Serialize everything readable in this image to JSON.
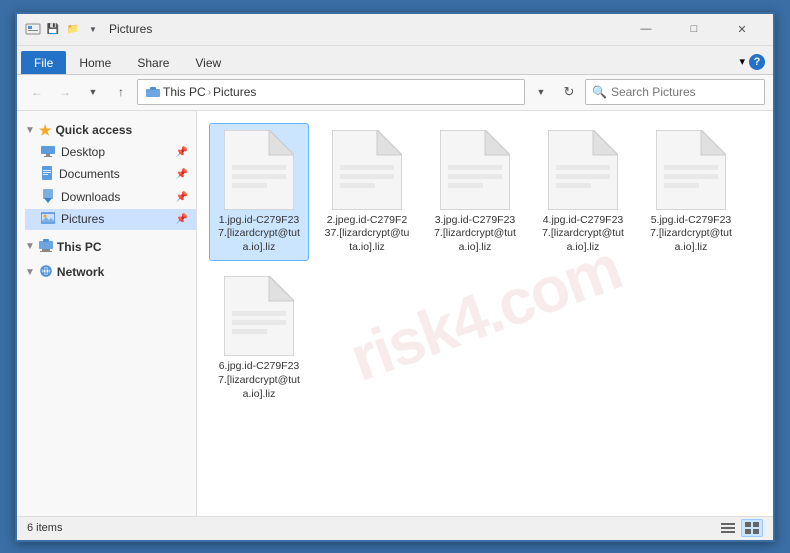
{
  "titlebar": {
    "title": "Pictures",
    "icon": "📁",
    "minimize": "—",
    "maximize": "□",
    "close": "✕"
  },
  "ribbon": {
    "tabs": [
      "File",
      "Home",
      "Share",
      "View"
    ],
    "active_tab": "File"
  },
  "addressbar": {
    "back_disabled": true,
    "forward_disabled": true,
    "up": "↑",
    "path_parts": [
      "This PC",
      "Pictures"
    ],
    "search_placeholder": "Search Pictures"
  },
  "sidebar": {
    "sections": [
      {
        "label": "Quick access",
        "icon": "★",
        "children": [
          {
            "label": "Desktop",
            "icon": "🖥",
            "pinned": true
          },
          {
            "label": "Documents",
            "icon": "📄",
            "pinned": true
          },
          {
            "label": "Downloads",
            "icon": "⬇",
            "pinned": true
          },
          {
            "label": "Pictures",
            "icon": "🖼",
            "pinned": true,
            "active": true
          }
        ]
      },
      {
        "label": "This PC",
        "icon": "💻",
        "children": []
      },
      {
        "label": "Network",
        "icon": "🌐",
        "children": []
      }
    ]
  },
  "files": [
    {
      "name": "1.jpg.id-C279F237.[lizardcrypt@tuta.io].liz",
      "selected": true
    },
    {
      "name": "2.jpeg.id-C279F237.[lizardcrypt@tuta.io].liz",
      "selected": false
    },
    {
      "name": "3.jpg.id-C279F237.[lizardcrypt@tuta.io].liz",
      "selected": false
    },
    {
      "name": "4.jpg.id-C279F237.[lizardcrypt@tuta.io].liz",
      "selected": false
    },
    {
      "name": "5.jpg.id-C279F237.[lizardcrypt@tuta.io].liz",
      "selected": false
    },
    {
      "name": "6.jpg.id-C279F237.[lizardcrypt@tuta.io].liz",
      "selected": false
    }
  ],
  "statusbar": {
    "count": "6 items"
  },
  "watermark": "risk4.com"
}
